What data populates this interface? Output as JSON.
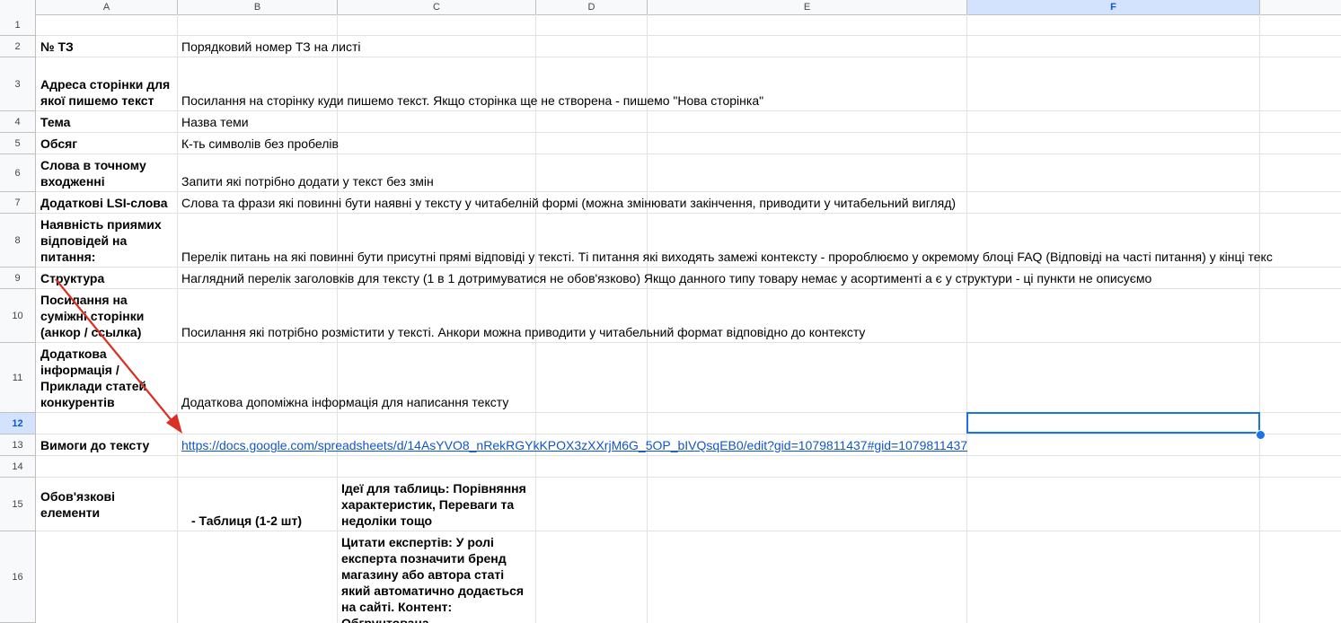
{
  "columns": [
    "A",
    "B",
    "C",
    "D",
    "E",
    "F"
  ],
  "selected_column": "F",
  "row_numbers": [
    "1",
    "2",
    "3",
    "4",
    "5",
    "6",
    "7",
    "8",
    "9",
    "10",
    "11",
    "12",
    "13",
    "14",
    "15",
    "16"
  ],
  "selected_row": "12",
  "rows": {
    "r2": {
      "a": "№ ТЗ",
      "b": "Порядковий номер ТЗ на листі"
    },
    "r3": {
      "a": "Адреса сторінки для якої пишемо текст",
      "b": "Посилання на сторінку куди пишемо текст. Якщо сторінка ще не створена - пишемо \"Нова сторінка\""
    },
    "r4": {
      "a": "Тема",
      "b": "Назва теми"
    },
    "r5": {
      "a": "Обсяг",
      "b": "К-ть символів без пробелів"
    },
    "r6": {
      "a": "Слова в точному входженні",
      "b": "Запити які потрібно додати у текст без змін"
    },
    "r7": {
      "a": "Додаткові LSI-слова",
      "b": "Слова та фрази які повинні бути наявні у тексту у читабелній формі (можна змінювати закінчення, приводити у читабельний вигляд)"
    },
    "r8": {
      "a": "Наявність приямих відповідей на питання:",
      "b": "Перелік питань на які повинні бути присутні прямі відповіді у тексті. Ті питання які виходять замежі контексту - пророблюємо у окремому блоці FAQ (Відповіді на часті питання) у кінці текс"
    },
    "r9": {
      "a": "Структура",
      "b": "Наглядний перелік заголовків для тексту (1 в 1 дотримуватися не обов'язково) Якщо данного типу товару немає у асортименті а є у структури - ці пункти не описуємо"
    },
    "r10": {
      "a": "Посилання на суміжні сторінки (анкор / ссылка)",
      "b": "Посилання які потрібно розмістити у тексті. Анкори можна приводити у читабельний формат відповідно до контексту"
    },
    "r11": {
      "a": "Додаткова інформація / Приклади статей конкурентів",
      "b": "Додаткова допоміжна інформація для написання тексту"
    },
    "r13": {
      "a": "Вимоги до тексту",
      "b": "https://docs.google.com/spreadsheets/d/14AsYVO8_nRekRGYkKPOX3zXXrjM6G_5OP_bIVQsqEB0/edit?gid=1079811437#gid=1079811437"
    },
    "r15": {
      "a": "Обов'язкові елементи",
      "b": "- Таблиця (1-2 шт)",
      "c": "Ідеї для таблиць: Порівняння характеристик, Переваги та недоліки тощо"
    },
    "r16": {
      "c": "Цитати експертів: У ролі експерта позначити бренд магазину або автора статі який автоматично додається на сайті. Контент: Обгрунтована"
    }
  },
  "colors": {
    "link": "#1155cc",
    "selection": "#1a73e8",
    "arrow": "#d93025",
    "header_selected": "#d3e3fd"
  }
}
